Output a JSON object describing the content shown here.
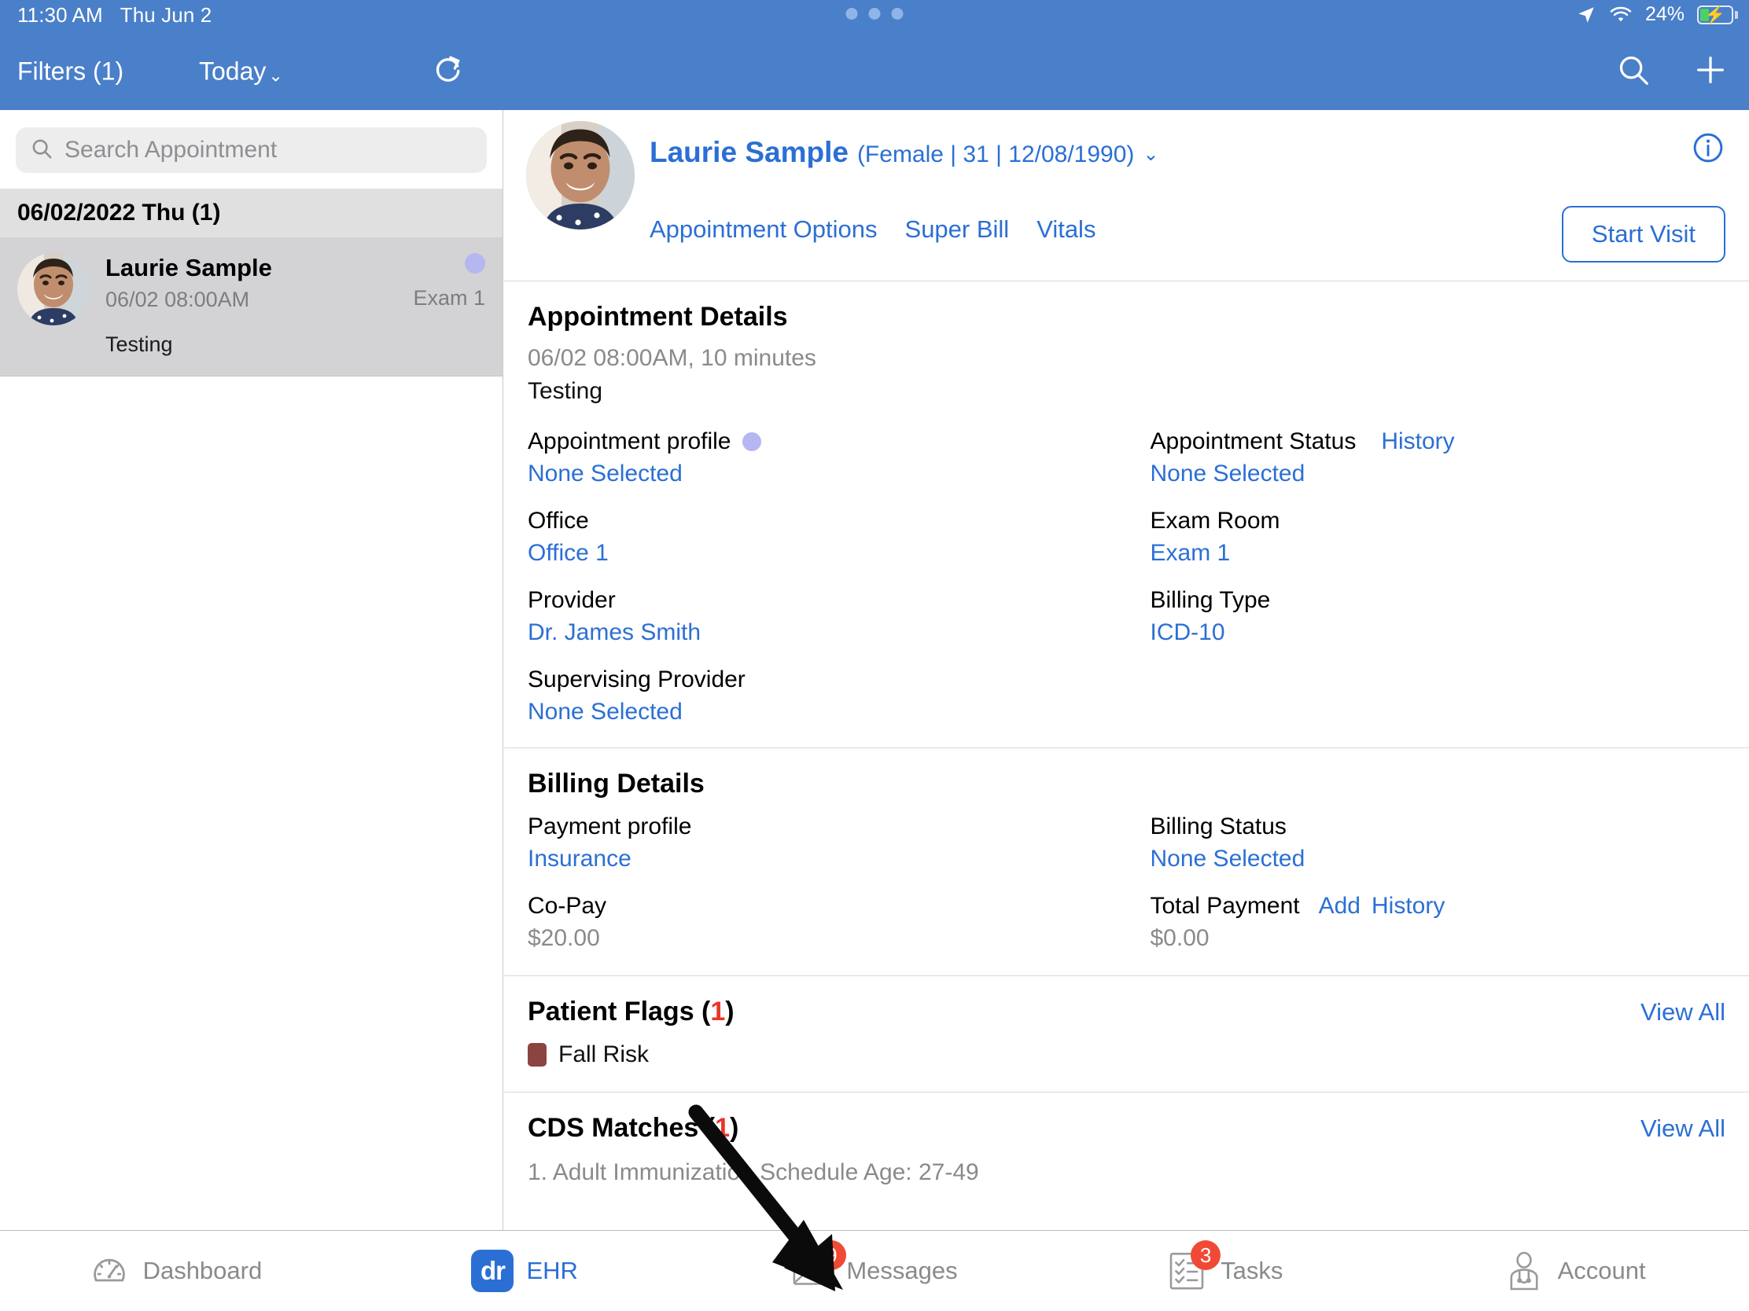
{
  "status_bar": {
    "time": "11:30 AM",
    "date": "Thu Jun 2",
    "battery_percent": "24%",
    "location_icon": "location-arrow-icon",
    "wifi_icon": "wifi-icon",
    "battery_icon": "battery-charging-icon",
    "multitask_indicator": "three-dots-icon"
  },
  "header": {
    "filters_label": "Filters (1)",
    "today_label": "Today",
    "chevron": "⌄",
    "refresh_icon": "refresh-icon",
    "search_icon": "search-icon",
    "add_icon": "plus-icon",
    "background_color": "#4a7fc9"
  },
  "sidebar": {
    "search": {
      "placeholder": "Search Appointment",
      "value": "",
      "icon": "search-icon"
    },
    "day_group": "06/02/2022 Thu (1)",
    "appointment": {
      "name": "Laurie Sample",
      "time": "06/02 08:00AM",
      "reason": "Testing",
      "room": "Exam 1",
      "profile_dot_color": "#b5b7f0"
    }
  },
  "patient": {
    "name": "Laurie Sample",
    "demographics": "(Female | 31 | 12/08/1990)",
    "chevron": "⌄",
    "links": [
      "Appointment Options",
      "Super Bill",
      "Vitals"
    ],
    "info_icon": "info-circle-icon",
    "start_visit_label": "Start Visit"
  },
  "appointment_details": {
    "title": "Appointment Details",
    "datetime": "06/02 08:00AM, 10 minutes",
    "reason": "Testing",
    "left_fields": [
      {
        "label": "Appointment profile",
        "value": "None Selected",
        "dot": "#b5b7f0"
      },
      {
        "label": "Office",
        "value": "Office 1"
      },
      {
        "label": "Provider",
        "value": "Dr. James Smith"
      },
      {
        "label": "Supervising Provider",
        "value": "None Selected"
      }
    ],
    "right_fields": [
      {
        "label": "Appointment Status",
        "link": "History",
        "value": "None Selected"
      },
      {
        "label": "Exam Room",
        "value": "Exam 1"
      },
      {
        "label": "Billing Type",
        "value": "ICD-10"
      }
    ]
  },
  "billing_details": {
    "title": "Billing Details",
    "left_fields": [
      {
        "label": "Payment profile",
        "value": "Insurance"
      },
      {
        "label": "Co-Pay",
        "value": "$20.00",
        "plain": true
      }
    ],
    "right_fields": [
      {
        "label": "Billing Status",
        "value": "None Selected"
      },
      {
        "label": "Total Payment",
        "link": "Add",
        "link2": "History",
        "value": "$0.00",
        "plain": true
      }
    ]
  },
  "patient_flags": {
    "title_prefix": "Patient Flags (",
    "count": "1",
    "title_suffix": ")",
    "view_all": "View All",
    "flags": [
      {
        "label": "Fall Risk",
        "color": "#8b4440"
      }
    ]
  },
  "cds_matches": {
    "title_prefix": "CDS Matches (",
    "count": "1",
    "title_suffix": ")",
    "view_all": "View All",
    "items": [
      "1. Adult Immunization Schedule Age: 27-49"
    ]
  },
  "tabbar": {
    "tabs": [
      {
        "label": "Dashboard",
        "icon": "gauge-icon",
        "badge": "",
        "active": false
      },
      {
        "label": "EHR",
        "icon": "dr-logo-icon",
        "badge": "",
        "active": true
      },
      {
        "label": "Messages",
        "icon": "envelope-icon",
        "badge": "9",
        "active": false
      },
      {
        "label": "Tasks",
        "icon": "checklist-icon",
        "badge": "3",
        "active": false
      },
      {
        "label": "Account",
        "icon": "doctor-icon",
        "badge": "",
        "active": false
      }
    ],
    "badge_color": "#f04a36",
    "accent_color": "#2b6fd4"
  },
  "annotation": {
    "arrow": "black-arrow-pointing-to-messages-tab"
  }
}
